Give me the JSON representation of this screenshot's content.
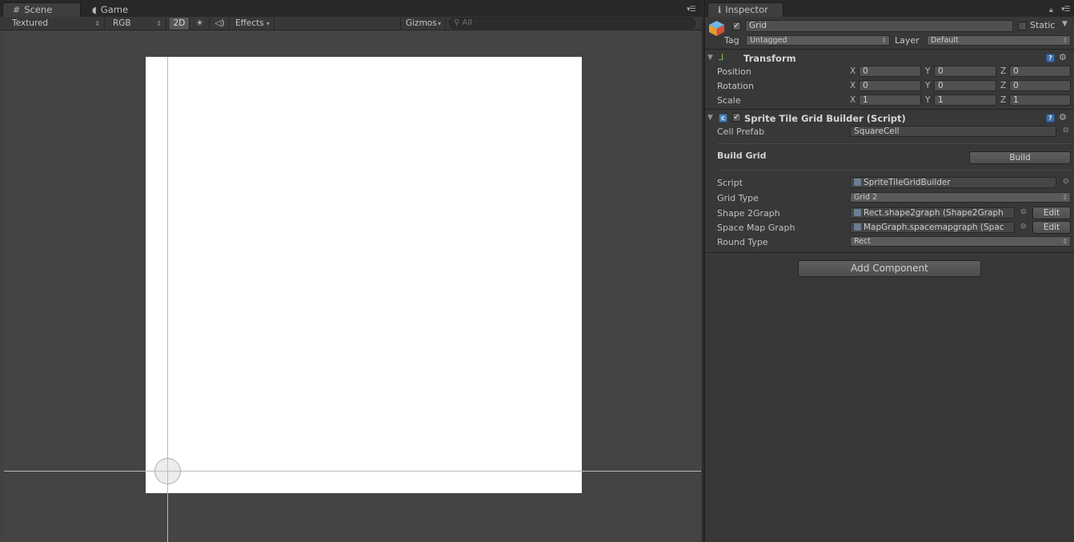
{
  "scene_tabs": {
    "scene_label": "Scene",
    "game_label": "Game"
  },
  "scene_toolbar": {
    "draw_mode": "Textured",
    "render_mode": "RGB",
    "mode_2d": "2D",
    "effects": "Effects",
    "gizmos": "Gizmos",
    "search_placeholder": "All"
  },
  "inspector": {
    "tab_label": "Inspector",
    "object_name": "Grid",
    "static_label": "Static",
    "tag_label": "Tag",
    "tag_value": "Untagged",
    "layer_label": "Layer",
    "layer_value": "Default",
    "transform": {
      "title": "Transform",
      "position_label": "Position",
      "rotation_label": "Rotation",
      "scale_label": "Scale",
      "axis_x": "X",
      "axis_y": "Y",
      "axis_z": "Z",
      "position": [
        "0",
        "0",
        "0"
      ],
      "rotation": [
        "0",
        "0",
        "0"
      ],
      "scale": [
        "1",
        "1",
        "1"
      ]
    },
    "builder": {
      "title": "Sprite Tile Grid Builder (Script)",
      "cell_prefab_label": "Cell Prefab",
      "cell_prefab_value": "SquareCell",
      "build_grid_label": "Build Grid",
      "build_button": "Build",
      "script_label": "Script",
      "script_value": "SpriteTileGridBuilder",
      "grid_type_label": "Grid Type",
      "grid_type_value": "Grid 2",
      "shape_label": "Shape 2Graph",
      "shape_value": "Rect.shape2graph (Shape2Graph",
      "space_map_label": "Space Map Graph",
      "space_map_value": "MapGraph.spacemapgraph (Spac",
      "edit_label": "Edit",
      "round_type_label": "Round Type",
      "round_type_value": "Rect"
    },
    "add_component": "Add Component"
  }
}
